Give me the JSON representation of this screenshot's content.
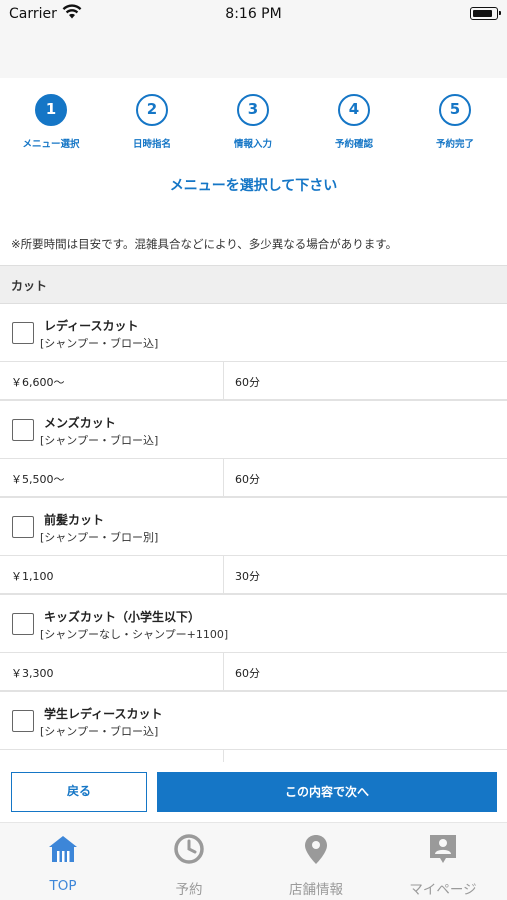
{
  "status_bar": {
    "carrier": "Carrier",
    "time": "8:16 PM"
  },
  "steps": [
    {
      "number": "1",
      "label": "メニュー選択",
      "active": true
    },
    {
      "number": "2",
      "label": "日時指名",
      "active": false
    },
    {
      "number": "3",
      "label": "情報入力",
      "active": false
    },
    {
      "number": "4",
      "label": "予約確認",
      "active": false
    },
    {
      "number": "5",
      "label": "予約完了",
      "active": false
    }
  ],
  "instruction": "メニューを選択して下さい",
  "note": "※所要時間は目安です。混雑具合などにより、多少異なる場合があります。",
  "category": "カット",
  "menu_items": [
    {
      "name": "レディースカット",
      "sub": "[シャンプー・ブロー込]",
      "price": "￥6,600〜",
      "duration": "60分",
      "checked": false
    },
    {
      "name": "メンズカット",
      "sub": "[シャンプー・ブロー込]",
      "price": "￥5,500〜",
      "duration": "60分",
      "checked": false
    },
    {
      "name": "前髪カット",
      "sub": "[シャンプー・ブロー別]",
      "price": "￥1,100",
      "duration": "30分",
      "checked": false
    },
    {
      "name": "キッズカット（小学生以下）",
      "sub": "[シャンプーなし・シャンプー+1100]",
      "price": "￥3,300",
      "duration": "60分",
      "checked": false
    },
    {
      "name": "学生レディースカット",
      "sub": "[シャンプー・ブロー込]",
      "price": "",
      "duration": "",
      "checked": false
    }
  ],
  "buttons": {
    "back": "戻る",
    "next": "この内容で次へ"
  },
  "tab_bar": [
    {
      "label": "TOP",
      "icon": "home-icon",
      "active": true
    },
    {
      "label": "予約",
      "icon": "clock-icon",
      "active": false
    },
    {
      "label": "店舗情報",
      "icon": "map-pin-icon",
      "active": false
    },
    {
      "label": "マイページ",
      "icon": "user-badge-icon",
      "active": false
    }
  ],
  "colors": {
    "accent": "#1576c6",
    "tab_active": "#3d86d8",
    "tab_inactive": "#9a9a9a"
  }
}
